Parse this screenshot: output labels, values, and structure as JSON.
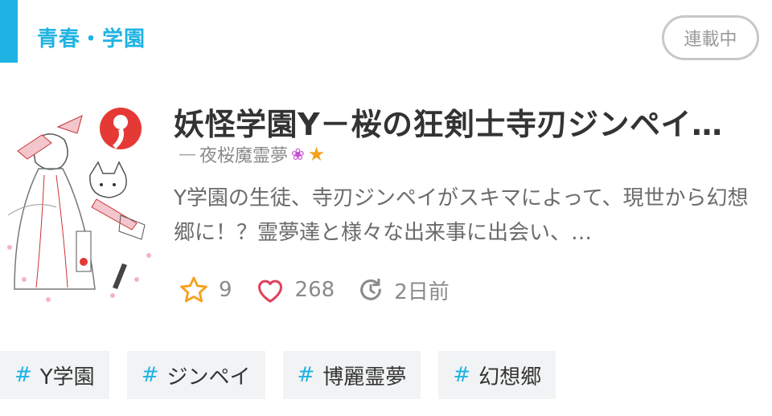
{
  "header": {
    "genre": "青春・学園",
    "status": "連載中"
  },
  "story": {
    "title": "妖怪学園Y－桜の狂剣士寺刃ジンペイ…",
    "author_prefix": "—",
    "author": "夜桜魔霊夢",
    "author_icons": [
      "flower-icon",
      "star-icon"
    ],
    "description": "Y学園の生徒、寺刃ジンペイがスキマによって、現世から幻想郷に！？霊夢達と様々な出来事に出会い、…"
  },
  "stats": {
    "stars": "9",
    "likes": "268",
    "updated": "2日前"
  },
  "tags": [
    {
      "hash": "#",
      "label": "Y学園"
    },
    {
      "hash": "#",
      "label": "ジンペイ"
    },
    {
      "hash": "#",
      "label": "博麗霊夢"
    },
    {
      "hash": "#",
      "label": "幻想郷"
    }
  ],
  "colors": {
    "accent": "#1fb3e3",
    "star": "#f5a11c",
    "heart": "#e0405a",
    "flower": "#c94fd6"
  }
}
